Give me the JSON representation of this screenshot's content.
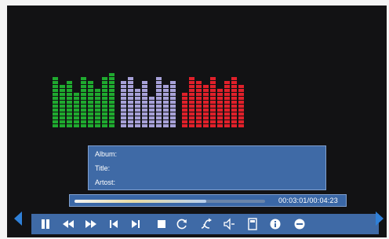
{
  "info": {
    "album_label": "Album:",
    "title_label": "Title:",
    "artist_label": "Artost:"
  },
  "playback": {
    "time_text": "00:03:01/00:04:23",
    "progress": 0.69
  },
  "equalizer": {
    "groups": [
      {
        "color": "#1faa2f",
        "levels": [
          13,
          11,
          12,
          9,
          13,
          12,
          10,
          13,
          14
        ]
      },
      {
        "color": "#a7a1d8",
        "levels": [
          12,
          13,
          10,
          12,
          8,
          13,
          11,
          12
        ]
      },
      {
        "color": "#e0202a",
        "levels": [
          9,
          13,
          12,
          11,
          13,
          10,
          12,
          13,
          11
        ]
      }
    ]
  },
  "toolbar_icons": [
    "pause-icon",
    "rewind-icon",
    "fast-forward-icon",
    "previous-track-icon",
    "next-track-icon",
    "stop-icon",
    "repeat-icon",
    "shuffle-icon",
    "mute-icon",
    "playlist-icon",
    "info-icon",
    "settings-icon"
  ],
  "colors": {
    "panel": "#3f6aa6",
    "screen": "#121214",
    "arrow": "#2f80d8"
  }
}
